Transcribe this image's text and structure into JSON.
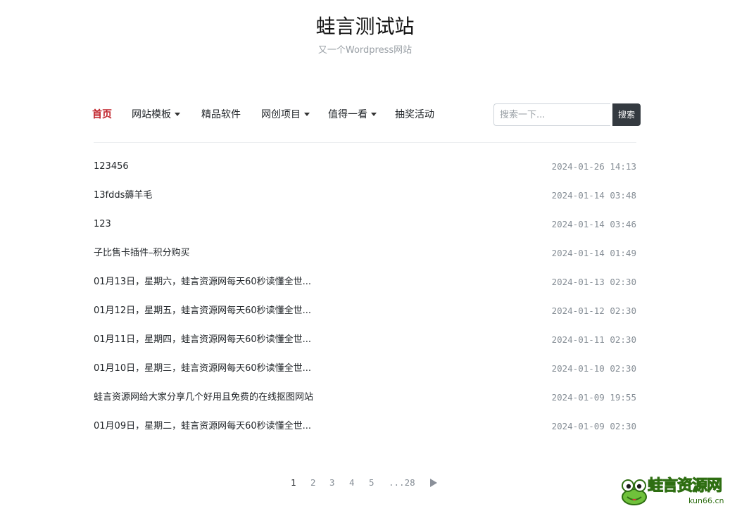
{
  "site": {
    "title": "蛙言测试站",
    "subtitle": "又一个Wordpress网站"
  },
  "nav": {
    "items": [
      {
        "label": "首页",
        "active": true,
        "dropdown": false
      },
      {
        "label": "网站模板",
        "active": false,
        "dropdown": true
      },
      {
        "label": "精品软件",
        "active": false,
        "dropdown": false
      },
      {
        "label": "网创项目",
        "active": false,
        "dropdown": true
      },
      {
        "label": "值得一看",
        "active": false,
        "dropdown": true
      },
      {
        "label": "抽奖活动",
        "active": false,
        "dropdown": false
      }
    ],
    "active_color": "#c0232b"
  },
  "search": {
    "placeholder": "搜索一下...",
    "button_label": "搜索"
  },
  "posts": [
    {
      "title": "123456",
      "date": "2024-01-26 14:13"
    },
    {
      "title": "13fdds薅羊毛",
      "date": "2024-01-14 03:48"
    },
    {
      "title": "123",
      "date": "2024-01-14 03:46"
    },
    {
      "title": "子比售卡插件–积分购买",
      "date": "2024-01-14 01:49"
    },
    {
      "title": "01月13日，星期六，蛙言资源网每天60秒读懂全世...",
      "date": "2024-01-13 02:30"
    },
    {
      "title": "01月12日，星期五，蛙言资源网每天60秒读懂全世...",
      "date": "2024-01-12 02:30"
    },
    {
      "title": "01月11日，星期四，蛙言资源网每天60秒读懂全世...",
      "date": "2024-01-11 02:30"
    },
    {
      "title": "01月10日，星期三，蛙言资源网每天60秒读懂全世...",
      "date": "2024-01-10 02:30"
    },
    {
      "title": "蛙言资源网给大家分享几个好用且免费的在线抠图网站",
      "date": "2024-01-09 19:55"
    },
    {
      "title": "01月09日，星期二，蛙言资源网每天60秒读懂全世...",
      "date": "2024-01-09 02:30"
    }
  ],
  "pagination": {
    "pages": [
      "1",
      "2",
      "3",
      "4",
      "5",
      "...28"
    ],
    "current": "1",
    "next_icon": "next-arrow-icon"
  },
  "watermark": {
    "text": "蛙言资源网",
    "domain": "kun66.cn"
  }
}
